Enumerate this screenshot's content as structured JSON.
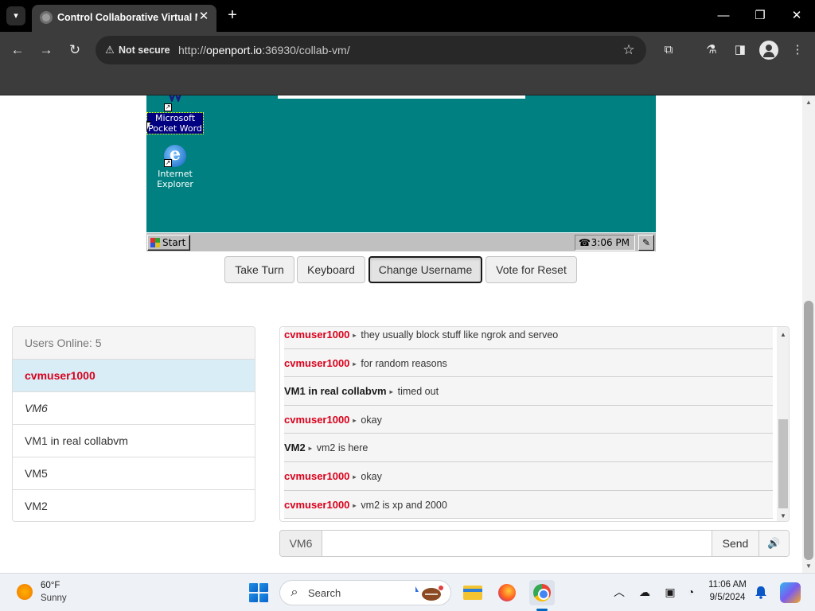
{
  "browser": {
    "tab_title": "Control Collaborative Virtual M",
    "security_label": "Not secure",
    "url_prefix": "http://",
    "url_host": "openport.io",
    "url_rest": ":36930/collab-vm/"
  },
  "vm": {
    "desktop_icons": [
      {
        "label": "Microsoft Pocket Word",
        "line1": "Microsoft",
        "line2": "Pocket Word",
        "icon": "pocket-word-icon",
        "selected": true
      },
      {
        "label": "Internet Explorer",
        "line1": "Internet",
        "line2": "Explorer",
        "icon": "internet-explorer-icon",
        "selected": false
      }
    ],
    "start_label": "Start",
    "clock": "3:06 PM",
    "desktop_color": "#008080"
  },
  "controls": {
    "take_turn": "Take Turn",
    "keyboard": "Keyboard",
    "change_username": "Change Username",
    "vote_reset": "Vote for Reset"
  },
  "users": {
    "heading": "Users Online: 5",
    "list": [
      "cvmuser1000",
      "VM6",
      "VM1 in real collabvm",
      "VM5",
      "VM2"
    ]
  },
  "chat": {
    "messages": [
      {
        "user": "cvmuser1000",
        "text": "they usually block stuff like ngrok and serveo"
      },
      {
        "user": "cvmuser1000",
        "text": "for random reasons"
      },
      {
        "user": "VM1 in real collabvm",
        "text": "timed out"
      },
      {
        "user": "cvmuser1000",
        "text": "okay"
      },
      {
        "user": "VM2",
        "text": "vm2 is here"
      },
      {
        "user": "cvmuser1000",
        "text": "okay"
      },
      {
        "user": "cvmuser1000",
        "text": "vm2 is xp and 2000"
      }
    ],
    "username_label": "VM6",
    "input_value": "",
    "send_label": "Send",
    "sound_icon": "speaker-icon"
  },
  "taskbar": {
    "weather_temp": "60°F",
    "weather_condition": "Sunny",
    "search_label": "Search",
    "time": "11:06 AM",
    "date": "9/5/2024"
  },
  "colors": {
    "own_username": "#d9001b",
    "own_user_row_bg": "#d9edf7",
    "accent": "#0067c0"
  }
}
